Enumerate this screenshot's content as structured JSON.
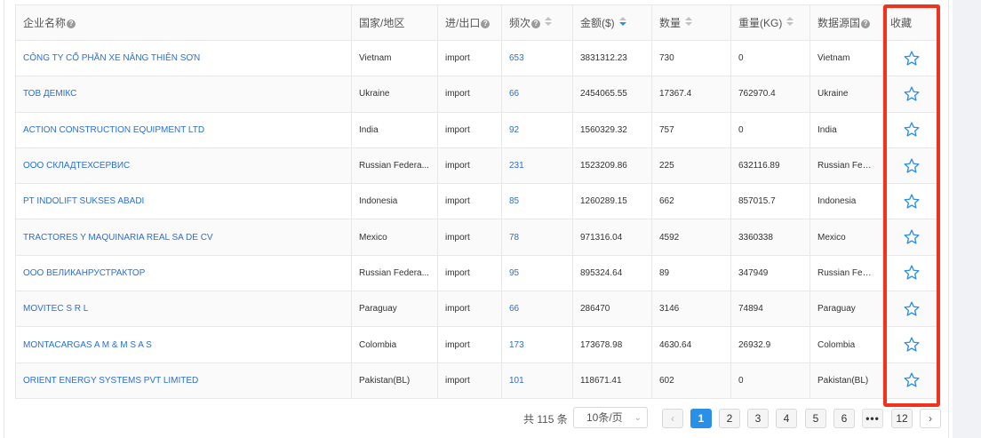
{
  "table": {
    "headers": [
      {
        "label": "企业名称",
        "help": true,
        "sortable": false
      },
      {
        "label": "国家/地区",
        "help": false,
        "sortable": false
      },
      {
        "label": "进/出口",
        "help": true,
        "sortable": false
      },
      {
        "label": "频次",
        "help": true,
        "sortable": true,
        "sort": "none"
      },
      {
        "label": "金额($)",
        "help": false,
        "sortable": true,
        "sort": "desc"
      },
      {
        "label": "数量",
        "help": false,
        "sortable": true,
        "sort": "none"
      },
      {
        "label": "重量(KG)",
        "help": false,
        "sortable": true,
        "sort": "none"
      },
      {
        "label": "数据源国",
        "help": true,
        "sortable": false
      },
      {
        "label": "收藏",
        "help": false,
        "sortable": false
      }
    ],
    "rows": [
      {
        "company": "CÔNG TY CỔ PHẦN XE NÂNG THIÊN SƠN",
        "country": "Vietnam",
        "direction": "import",
        "frequency": "653",
        "amount": "3831312.23",
        "quantity": "730",
        "weight": "0",
        "source": "Vietnam"
      },
      {
        "company": "ТОВ ДЕМІКС",
        "country": "Ukraine",
        "direction": "import",
        "frequency": "66",
        "amount": "2454065.55",
        "quantity": "17367.4",
        "weight": "762970.4",
        "source": "Ukraine"
      },
      {
        "company": "ACTION CONSTRUCTION EQUIPMENT LTD",
        "country": "India",
        "direction": "import",
        "frequency": "92",
        "amount": "1560329.32",
        "quantity": "757",
        "weight": "0",
        "source": "India"
      },
      {
        "company": "ООО СКЛАДТЕХСЕРВИС",
        "country": "Russian Federa...",
        "direction": "import",
        "frequency": "231",
        "amount": "1523209.86",
        "quantity": "225",
        "weight": "632116.89",
        "source": "Russian Fede..."
      },
      {
        "company": "PT INDOLIFT SUKSES ABADI",
        "country": "Indonesia",
        "direction": "import",
        "frequency": "85",
        "amount": "1260289.15",
        "quantity": "662",
        "weight": "857015.7",
        "source": "Indonesia"
      },
      {
        "company": "TRACTORES Y MAQUINARIA REAL SA DE CV",
        "country": "Mexico",
        "direction": "import",
        "frequency": "78",
        "amount": "971316.04",
        "quantity": "4592",
        "weight": "3360338",
        "source": "Mexico"
      },
      {
        "company": "ООО ВЕЛИКАНРУСТРАКТОР",
        "country": "Russian Federa...",
        "direction": "import",
        "frequency": "95",
        "amount": "895324.64",
        "quantity": "89",
        "weight": "347949",
        "source": "Russian Fede..."
      },
      {
        "company": "MOVITEC S R L",
        "country": "Paraguay",
        "direction": "import",
        "frequency": "66",
        "amount": "286470",
        "quantity": "3146",
        "weight": "74894",
        "source": "Paraguay"
      },
      {
        "company": "MONTACARGAS A M & M S A S",
        "country": "Colombia",
        "direction": "import",
        "frequency": "173",
        "amount": "173678.98",
        "quantity": "4630.64",
        "weight": "26932.9",
        "source": "Colombia"
      },
      {
        "company": "ORIENT ENERGY SYSTEMS PVT LIMITED",
        "country": "Pakistan(BL)",
        "direction": "import",
        "frequency": "101",
        "amount": "118671.41",
        "quantity": "602",
        "weight": "0",
        "source": "Pakistan(BL)"
      }
    ],
    "favorite_icon": "star-outline-icon"
  },
  "pagination": {
    "total_label": "共 115 条",
    "page_size_label": "10条/页",
    "pages": [
      "1",
      "2",
      "3",
      "4",
      "5",
      "6",
      "•••",
      "12"
    ],
    "current_page": "1",
    "prev_icon": "chevron-left-icon",
    "next_icon": "chevron-right-icon"
  },
  "colors": {
    "link": "#2b6fd6",
    "accent": "#2b8fe8",
    "highlight": "#f0321e",
    "star": "#2b8fe8"
  }
}
